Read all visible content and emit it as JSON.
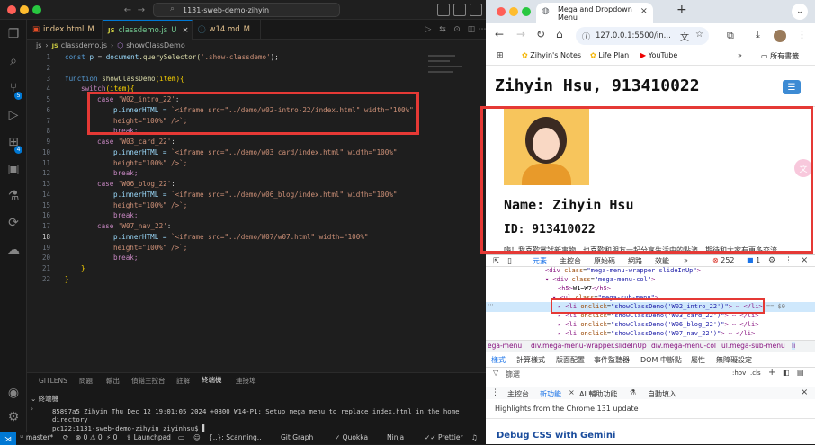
{
  "vscode": {
    "search_text": "1131-sweb-demo-zihyin",
    "tabs": [
      {
        "name": "index.html",
        "mark": "M"
      },
      {
        "name": "classdemo.js",
        "mark": "U"
      },
      {
        "name": "w14.md",
        "mark": "M"
      }
    ],
    "breadcrumb": {
      "folder": "js",
      "file": "classdemo.js",
      "symbol": "showClassDemo"
    },
    "line_numbers": [
      "1",
      "2",
      "3",
      "4",
      "5",
      "6",
      "7",
      "8",
      "9",
      "10",
      "11",
      "12",
      "13",
      "14",
      "15",
      "16",
      "17",
      "18",
      "19",
      "20",
      "21",
      "22"
    ],
    "code": {
      "l1_kw": "const ",
      "l1_var": "p",
      " l1_eq": " = ",
      "l1_obj": "document",
      "l1_fn": ".querySelector(",
      "l1_str": "'.show-classdemo'",
      "l1_end": ");",
      "l3_kw": "function ",
      "l3_fn": "showClassDemo",
      "l3_args": "(item){",
      "l4_kw": "switch",
      "l4_rest": "(item){",
      "case1": "'W02_intro_22'",
      "case2": "'W03_card_22'",
      "case3": "'W06_blog_22'",
      "case4": "'W07_nav_22'",
      "case_kw": "case ",
      "colon": ":",
      "inner": "p.innerHTML = ",
      "iframe1": "`<iframe src=\"../demo/w02-intro-22/index.html\" width=\"100%\"",
      "iframe2": "`<iframe src=\"../demo/w03_card/index.html\" width=\"100%\"",
      "iframe3": "`<iframe src=\"../demo/w06_blog/index.html\" width=\"100%\"",
      "iframe4": "`<iframe src=\"../demo/W07/w07.html\" width=\"100%\"",
      "height": "height=\"100%\" />`;",
      "brk": "break;",
      "close_brace": "}"
    },
    "panel": {
      "tabs": [
        "GITLENS",
        "問題",
        "輸出",
        "偵錯主控台",
        "註解",
        "終端機",
        "連接埠"
      ],
      "terminal_label": "終端機",
      "line1": "85897a5 Zihyin  Thu Dec 12 19:01:05 2024 +0800  W14-P1: Setup mega menu to replace index.html in the home",
      "line2": "directory",
      "line3": "pc122:1131-sweb-demo-zihyin ziyinhsu$ ▌"
    },
    "status": {
      "branch": "master*",
      "errors": "⊗ 0 ⚠ 0",
      "ports": "⚡ 0",
      "launchpad": "Launchpad",
      "scanning": "{..}: Scanning..",
      "git_graph": "Git Graph",
      "quokka": "Quokka",
      "ninja": "Ninja",
      "prettier": "Prettier"
    }
  },
  "chrome": {
    "tab_title": "Mega and Dropdown Menu",
    "url": "127.0.0.1:5500/in...",
    "bookmarks": [
      "Zihyin's Notes",
      "Life Plan",
      "YouTube"
    ],
    "all_bookmarks": "所有書籤",
    "page": {
      "heading": "Zihyin Hsu, 913410022",
      "name": "Name: Zihyin Hsu",
      "id": "ID: 913410022",
      "desc": "嗨！我喜歡嘗試新事物，也喜歡和朋友一起分享生活中的點滴，期待和大家有更多交流"
    },
    "devtools": {
      "tabs": [
        "元素",
        "主控台",
        "原始碼",
        "網路",
        "效能"
      ],
      "more": "»",
      "issues": "252",
      "warn": "1",
      "html": [
        {
          "tag": "div",
          "attr": "class",
          "val": "mega-menu-wrapper slideInUp"
        },
        {
          "tag": "div",
          "attr": "class",
          "val": "mega-menu-col"
        },
        {
          "tag": "h5",
          "text": "W1~W7"
        },
        {
          "tag": "ul",
          "attr": "class",
          "val": "mega-sub-menu"
        },
        {
          "tag": "li",
          "attr": "onclick",
          "val": "showClassDemo('W02_intro_22')",
          "eq": "== $0"
        },
        {
          "tag": "li",
          "attr": "onclick",
          "val": "showClassDemo('W03_card_22')"
        },
        {
          "tag": "li",
          "attr": "onclick",
          "val": "showClassDemo('W06_blog_22')"
        },
        {
          "tag": "li",
          "attr": "onclick",
          "val": "showClassDemo('W07_nav_22')"
        }
      ],
      "crumbs": [
        "ega-menu",
        "div.mega-menu-wrapper.slideInUp",
        "div.mega-menu-col",
        "ul.mega-sub-menu",
        "li"
      ],
      "style_tabs": [
        "樣式",
        "計算樣式",
        "版面配置",
        "事件監聽器",
        "DOM 中斷點",
        "屬性",
        "無障礙設定"
      ],
      "filter": "篩選",
      "hov": ":hov",
      "cls": ".cls",
      "drawer_tabs": [
        "主控台",
        "新功能",
        "AI 輔助功能",
        "自動填入"
      ],
      "highlights": "Highlights from the Chrome 131 update",
      "gemini": "Debug CSS with Gemini"
    }
  }
}
